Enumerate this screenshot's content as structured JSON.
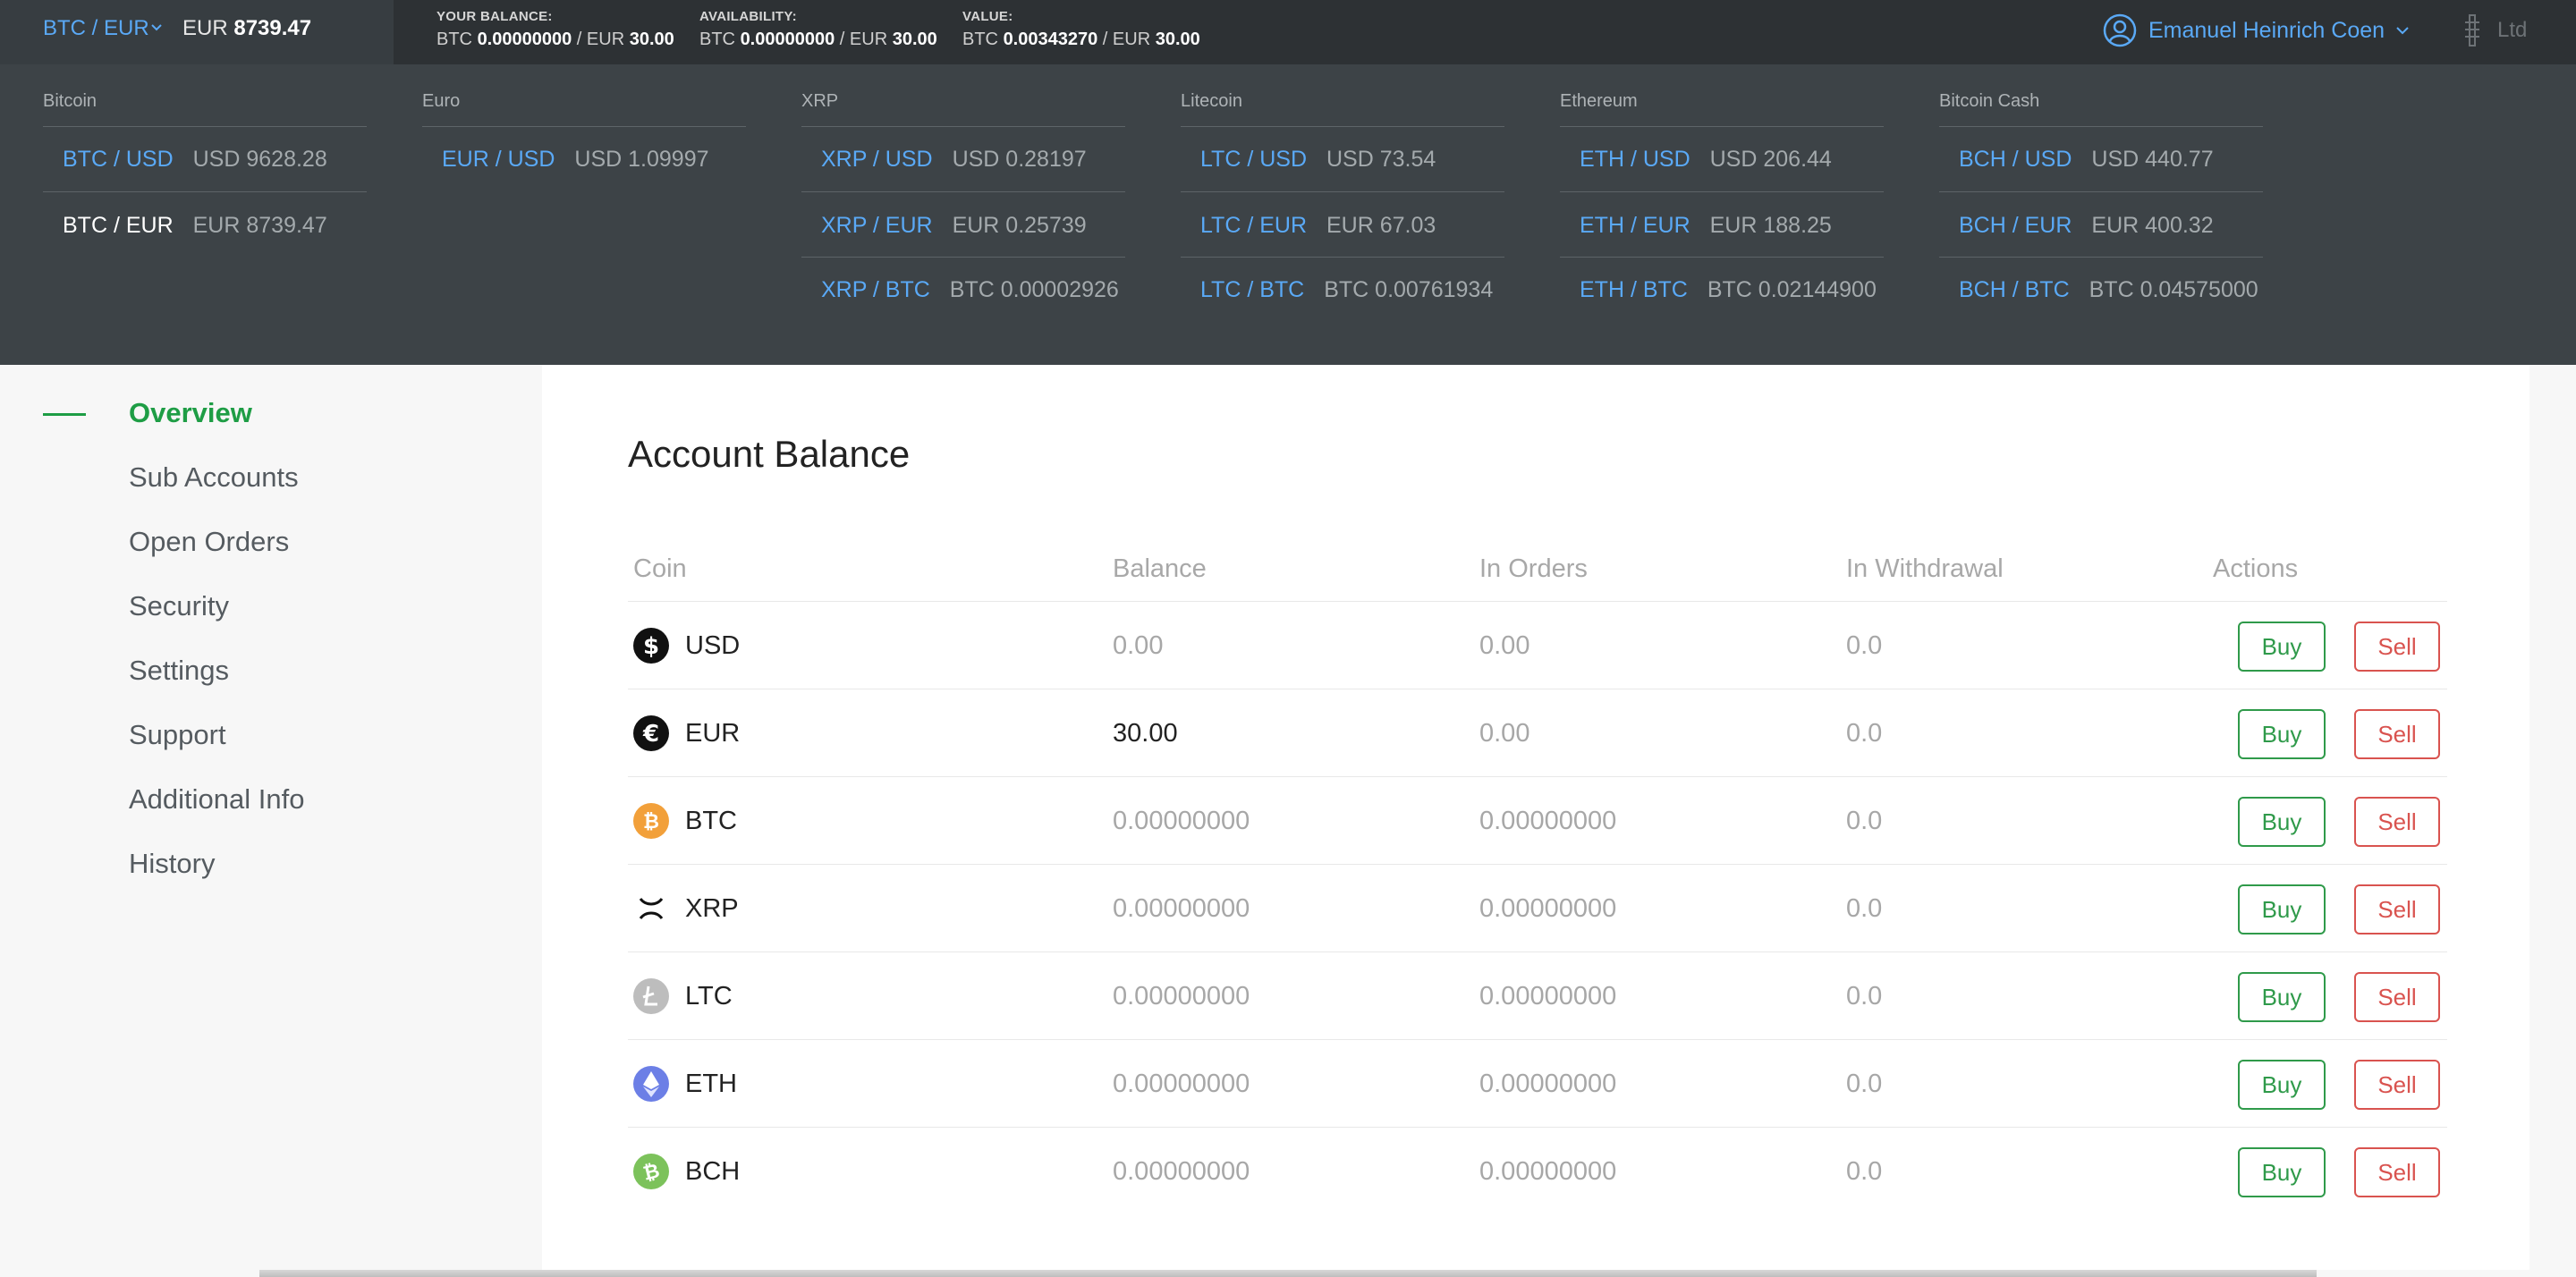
{
  "topbar": {
    "pair_selector": {
      "pair": "BTC / EUR",
      "currency": "EUR",
      "price": "8739.47"
    },
    "balance": {
      "label": "YOUR BALANCE:",
      "btc_label": "BTC",
      "btc_value": "0.00000000",
      "sep": "/",
      "eur_label": "EUR",
      "eur_value": "30.00"
    },
    "availability": {
      "label": "AVAILABILITY:",
      "btc_label": "BTC",
      "btc_value": "0.00000000",
      "sep": "/",
      "eur_label": "EUR",
      "eur_value": "30.00"
    },
    "value": {
      "label": "VALUE:",
      "btc_label": "BTC",
      "btc_value": "0.00343270",
      "sep": "/",
      "eur_label": "EUR",
      "eur_value": "30.00"
    },
    "user_name": "Emanuel Heinrich Coen",
    "company": "Ltd"
  },
  "markets": [
    {
      "title": "Bitcoin",
      "rows": [
        {
          "pair": "BTC / USD",
          "value": "USD 9628.28"
        },
        {
          "pair": "BTC / EUR",
          "value": "EUR 8739.47",
          "active": true
        }
      ]
    },
    {
      "title": "Euro",
      "rows": [
        {
          "pair": "EUR / USD",
          "value": "USD 1.09997"
        }
      ]
    },
    {
      "title": "XRP",
      "rows": [
        {
          "pair": "XRP / USD",
          "value": "USD 0.28197"
        },
        {
          "pair": "XRP / EUR",
          "value": "EUR 0.25739"
        },
        {
          "pair": "XRP / BTC",
          "value": "BTC 0.00002926"
        }
      ]
    },
    {
      "title": "Litecoin",
      "rows": [
        {
          "pair": "LTC / USD",
          "value": "USD 73.54"
        },
        {
          "pair": "LTC / EUR",
          "value": "EUR 67.03"
        },
        {
          "pair": "LTC / BTC",
          "value": "BTC 0.00761934"
        }
      ]
    },
    {
      "title": "Ethereum",
      "rows": [
        {
          "pair": "ETH / USD",
          "value": "USD 206.44"
        },
        {
          "pair": "ETH / EUR",
          "value": "EUR 188.25"
        },
        {
          "pair": "ETH / BTC",
          "value": "BTC 0.02144900"
        }
      ]
    },
    {
      "title": "Bitcoin Cash",
      "rows": [
        {
          "pair": "BCH / USD",
          "value": "USD 440.77"
        },
        {
          "pair": "BCH / EUR",
          "value": "EUR 400.32"
        },
        {
          "pair": "BCH / BTC",
          "value": "BTC 0.04575000"
        }
      ]
    }
  ],
  "sidebar": {
    "items": [
      {
        "label": "Overview",
        "active": true
      },
      {
        "label": "Sub Accounts"
      },
      {
        "label": "Open Orders"
      },
      {
        "label": "Security"
      },
      {
        "label": "Settings"
      },
      {
        "label": "Support"
      },
      {
        "label": "Additional Info"
      },
      {
        "label": "History"
      }
    ]
  },
  "main": {
    "title": "Account Balance",
    "columns": [
      "Coin",
      "Balance",
      "In Orders",
      "In Withdrawal",
      "Actions"
    ],
    "buy_label": "Buy",
    "sell_label": "Sell",
    "rows": [
      {
        "coin": "USD",
        "icon": "usd-icon",
        "balance": "0.00",
        "in_orders": "0.00",
        "in_withdrawal": "0.0"
      },
      {
        "coin": "EUR",
        "icon": "eur-icon",
        "balance": "30.00",
        "in_orders": "0.00",
        "in_withdrawal": "0.0",
        "balance_highlight": true
      },
      {
        "coin": "BTC",
        "icon": "btc-icon",
        "balance": "0.00000000",
        "in_orders": "0.00000000",
        "in_withdrawal": "0.0"
      },
      {
        "coin": "XRP",
        "icon": "xrp-icon",
        "balance": "0.00000000",
        "in_orders": "0.00000000",
        "in_withdrawal": "0.0"
      },
      {
        "coin": "LTC",
        "icon": "ltc-icon",
        "balance": "0.00000000",
        "in_orders": "0.00000000",
        "in_withdrawal": "0.0"
      },
      {
        "coin": "ETH",
        "icon": "eth-icon",
        "balance": "0.00000000",
        "in_orders": "0.00000000",
        "in_withdrawal": "0.0"
      },
      {
        "coin": "BCH",
        "icon": "bch-icon",
        "balance": "0.00000000",
        "in_orders": "0.00000000",
        "in_withdrawal": "0.0"
      }
    ]
  },
  "colors": {
    "accent_blue": "#5aa9f6",
    "accent_green": "#1e9d45",
    "buy_green": "#2f9a4a",
    "sell_red": "#d9534f",
    "header_dark": "#2d3134",
    "panel_dark": "#3d4347"
  }
}
